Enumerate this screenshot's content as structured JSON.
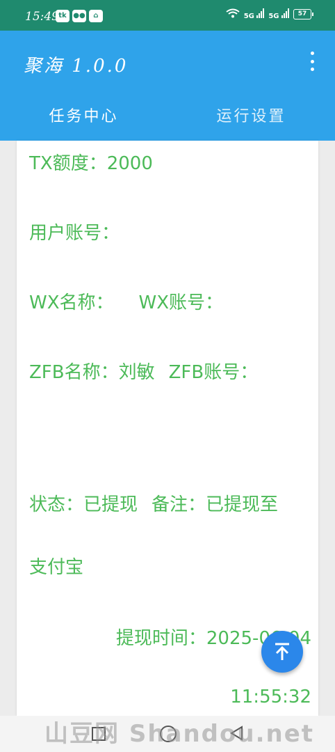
{
  "status_bar": {
    "time": "15:49",
    "network": "5G",
    "battery": "57"
  },
  "app_bar": {
    "title": "聚海 1.0.0",
    "tabs": [
      {
        "label": "任务中心"
      },
      {
        "label": "运行设置"
      }
    ]
  },
  "record": {
    "tx_quota": "TX额度：2000",
    "user_account": "用户账号：",
    "wx_name": "WX名称：",
    "wx_account": "WX账号：",
    "zfb_name": "ZFB名称：刘敏",
    "zfb_account": "ZFB账号：",
    "status": "状态：已提现",
    "remark_part1": "备注：已提现至",
    "remark_part2": "支付宝",
    "withdraw_time_label": "提现时间：2025-06-04",
    "withdraw_time_clock": "11:55:32"
  },
  "watermark": "山豆网 Shandou.net",
  "colors": {
    "status_bar": "#1f8a6e",
    "app_bar": "#2fa3ea",
    "text_green": "#4cba58",
    "fab": "#2b87ea"
  },
  "icons": {
    "fab": "arrow-up-to-top-icon",
    "menu": "more-vert-icon"
  }
}
